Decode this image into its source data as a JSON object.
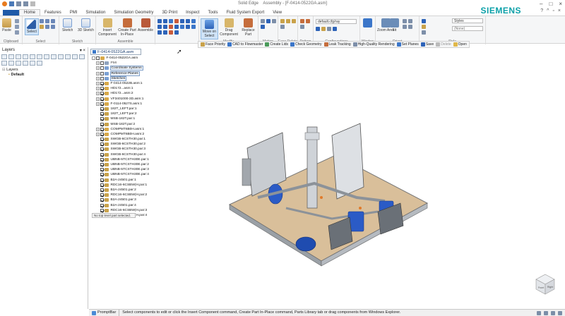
{
  "titlebar": {
    "app": "Solid Edge",
    "doc": "Assembly - [F-0414-0522GA.asm]"
  },
  "tabs": [
    "Home",
    "Features",
    "PMI",
    "Simulation",
    "Simulation Geometry",
    "3D Print",
    "Inspect",
    "Tools",
    "Fluid System Export",
    "View"
  ],
  "brand": "SIEMENS",
  "ribbon": {
    "groups": [
      {
        "name": "Clipboard",
        "buttons": [
          "Paste"
        ]
      },
      {
        "name": "Select",
        "buttons": [
          "Select"
        ]
      },
      {
        "name": "Sketch",
        "buttons": [
          "Sketch",
          "3D Sketch"
        ]
      },
      {
        "name": "Assemble",
        "buttons": [
          "Insert Component",
          "Create Part In-Place",
          "Assemble"
        ]
      },
      {
        "name": "Modify",
        "buttons": [
          "Move on Select",
          "Drag Component",
          "Replace Part"
        ]
      },
      {
        "name": "Motion",
        "buttons": []
      },
      {
        "name": "Face Relate",
        "buttons": []
      },
      {
        "name": "Pattern",
        "buttons": []
      },
      {
        "name": "Configurations",
        "buttons": []
      },
      {
        "name": "Window",
        "buttons": []
      },
      {
        "name": "Orient",
        "buttons": [
          "Zoom Area",
          "Fit"
        ]
      },
      {
        "name": "Style",
        "buttons": [
          "Styles"
        ]
      }
    ],
    "config_value": "default.cfg/ray",
    "style_value": "(None)"
  },
  "cmdbar": [
    {
      "label": "Face Priority",
      "enabled": true
    },
    {
      "label": "CAD to Flowmaster",
      "enabled": true
    },
    {
      "label": "Create Lids",
      "enabled": true
    },
    {
      "label": "Check Geometry",
      "enabled": true
    },
    {
      "label": "Leak Tracking",
      "enabled": true
    },
    {
      "label": "High-Quality Rendering",
      "enabled": true
    },
    {
      "label": "Set Planes",
      "enabled": true
    },
    {
      "label": "Save",
      "enabled": true
    },
    {
      "label": "Delete",
      "enabled": false
    },
    {
      "label": "Open",
      "enabled": true
    }
  ],
  "layers": {
    "title": "Layers",
    "tree_root": "Layers",
    "tree_child": "Default"
  },
  "pathfinder": {
    "tab": "F-0414-0522GA.asm",
    "rows": [
      {
        "t": "F-0414-0522GA.asm",
        "indent": 0,
        "exp": "-",
        "chk": false,
        "icon": "asm",
        "style": "plain"
      },
      {
        "t": "PMI",
        "indent": 1,
        "exp": "+",
        "chk": false,
        "icon": "pmi",
        "style": "gray"
      },
      {
        "t": "Coordinate Systems",
        "indent": 1,
        "exp": "+",
        "chk": false,
        "icon": "cs",
        "style": "boxed"
      },
      {
        "t": "Reference Planes",
        "indent": 1,
        "exp": "+",
        "chk": false,
        "icon": "rp",
        "style": "boxed"
      },
      {
        "t": "Sketches",
        "indent": 1,
        "exp": "+",
        "chk": false,
        "icon": "sk",
        "style": "boxed"
      },
      {
        "t": "F-0414-0522B.asm:1",
        "indent": 1,
        "exp": "+",
        "chk": true,
        "icon": "asm",
        "style": "plain"
      },
      {
        "t": "HD172...asm:1",
        "indent": 1,
        "exp": "+",
        "chk": true,
        "icon": "asm",
        "style": "plain"
      },
      {
        "t": "HD172...asm:2",
        "indent": 1,
        "exp": "+",
        "chk": true,
        "icon": "asm",
        "style": "plain"
      },
      {
        "t": "VF3401000-3D.asm:1",
        "indent": 1,
        "exp": "+",
        "chk": true,
        "icon": "asm",
        "style": "plain"
      },
      {
        "t": "F-0114-0527S.asm:1",
        "indent": 1,
        "exp": "+",
        "chk": true,
        "icon": "asm",
        "style": "plain"
      },
      {
        "t": "182T_LEFT.par:1",
        "indent": 1,
        "exp": "",
        "chk": true,
        "icon": "par",
        "style": "plain"
      },
      {
        "t": "182T_LEFT.par:2",
        "indent": 1,
        "exp": "",
        "chk": true,
        "icon": "par",
        "style": "plain"
      },
      {
        "t": "MSB-182T.par:1",
        "indent": 1,
        "exp": "",
        "chk": true,
        "icon": "par",
        "style": "plain"
      },
      {
        "t": "MSB-182T.par:2",
        "indent": 1,
        "exp": "",
        "chk": true,
        "icon": "par",
        "style": "plain"
      },
      {
        "t": "COMPMT6B0H.asm:1",
        "indent": 1,
        "exp": "+",
        "chk": true,
        "icon": "asm",
        "style": "plain"
      },
      {
        "t": "COMPMT6B0H.asm:2",
        "indent": 1,
        "exp": "+",
        "chk": true,
        "icon": "asm",
        "style": "plain"
      },
      {
        "t": "SWGB-6CSTH30.par:1",
        "indent": 1,
        "exp": "",
        "chk": true,
        "icon": "par",
        "style": "plain"
      },
      {
        "t": "SWGB-6CSTH30.par:2",
        "indent": 1,
        "exp": "",
        "chk": true,
        "icon": "par",
        "style": "plain"
      },
      {
        "t": "SWGB-6CSTH30.par:3",
        "indent": 1,
        "exp": "",
        "chk": true,
        "icon": "par",
        "style": "plain"
      },
      {
        "t": "SWGB-6CSTH30.par:4",
        "indent": 1,
        "exp": "",
        "chk": true,
        "icon": "par",
        "style": "plain"
      },
      {
        "t": "UBNB-5TCSTH30E.par:1",
        "indent": 1,
        "exp": "",
        "chk": true,
        "icon": "par",
        "style": "plain"
      },
      {
        "t": "UBNB-5TCSTH30E.par:2",
        "indent": 1,
        "exp": "",
        "chk": true,
        "icon": "par",
        "style": "plain"
      },
      {
        "t": "UBNB-5TCSTH30E.par:3",
        "indent": 1,
        "exp": "",
        "chk": true,
        "icon": "par",
        "style": "plain"
      },
      {
        "t": "UBNB-5TCSTH30E.par:4",
        "indent": 1,
        "exp": "",
        "chk": true,
        "icon": "par",
        "style": "plain"
      },
      {
        "t": "B2A-24501.par:1",
        "indent": 1,
        "exp": "",
        "chk": true,
        "icon": "par",
        "style": "plain"
      },
      {
        "t": "RDC16-6CSBW(H.par:1",
        "indent": 1,
        "exp": "",
        "chk": true,
        "icon": "par",
        "style": "plain"
      },
      {
        "t": "B2A-24501.par:2",
        "indent": 1,
        "exp": "",
        "chk": true,
        "icon": "par",
        "style": "plain"
      },
      {
        "t": "RDC16-6CSBW(H.par:2",
        "indent": 1,
        "exp": "",
        "chk": true,
        "icon": "par",
        "style": "plain"
      },
      {
        "t": "B2A-24501.par:3",
        "indent": 1,
        "exp": "",
        "chk": true,
        "icon": "par",
        "style": "plain"
      },
      {
        "t": "B2A-24501.par:4",
        "indent": 1,
        "exp": "",
        "chk": true,
        "icon": "par",
        "style": "plain"
      },
      {
        "t": "RDC16-6CSBW(H.par:3",
        "indent": 1,
        "exp": "",
        "chk": true,
        "icon": "par",
        "style": "plain"
      },
      {
        "t": "RDC16-6CSBW(H.par:4",
        "indent": 1,
        "exp": "",
        "chk": true,
        "icon": "par",
        "style": "plain"
      }
    ],
    "no_selection": "No top level part selected."
  },
  "viewcube": {
    "front": "Front",
    "right": "Right"
  },
  "status": {
    "prompt_label": "PromptBar",
    "message": "Select components to edit or click the Insert Component command, Create Part In-Place command, Parts Library tab or drag components from Windows Explorer."
  },
  "colors": {
    "file_tab": "#1e5aa8",
    "brand": "#0aa0a8",
    "selected": "#cfe3f7",
    "motor_blue": "#2b5bc6",
    "base_tan": "#d9bf9a",
    "frame_gray": "#9aa0a6"
  }
}
